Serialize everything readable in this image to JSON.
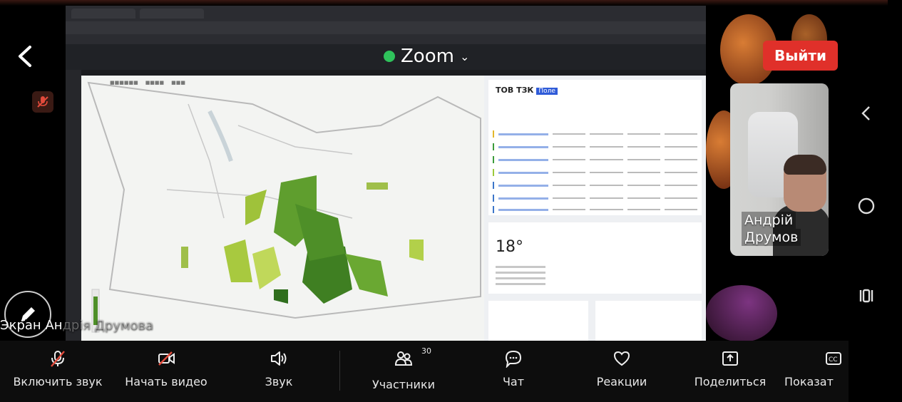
{
  "meeting": {
    "app_title": "Zoom",
    "leave_label": "Выйти"
  },
  "participant": {
    "name_line1": "Андрій",
    "name_line2": "Друмов"
  },
  "shared_screen": {
    "caption_visible": "Экран Ан",
    "caption_faded": "дрія Друмова",
    "panel_title": "ТОВ ТЗК",
    "panel_title_selected": "Поле",
    "temperature": "18°"
  },
  "toolbar": {
    "unmute_label": "Включить звук",
    "start_video_label": "Начать видео",
    "audio_label": "Звук",
    "participants_label": "Участники",
    "participants_count": "30",
    "chat_label": "Чат",
    "reactions_label": "Реакции",
    "share_label": "Поделиться",
    "captions_label": "Показат"
  },
  "colors": {
    "leave_button": "#e0302a",
    "status_dot": "#2fc25b",
    "accent_orange": "#f08a3a"
  },
  "icons": {
    "back": "chevron-left-icon",
    "mute": "mic-muted-icon",
    "pencil": "pencil-icon",
    "nav_back": "chevron-left-icon",
    "nav_home": "circle-home-icon",
    "nav_recent": "recent-apps-icon"
  }
}
